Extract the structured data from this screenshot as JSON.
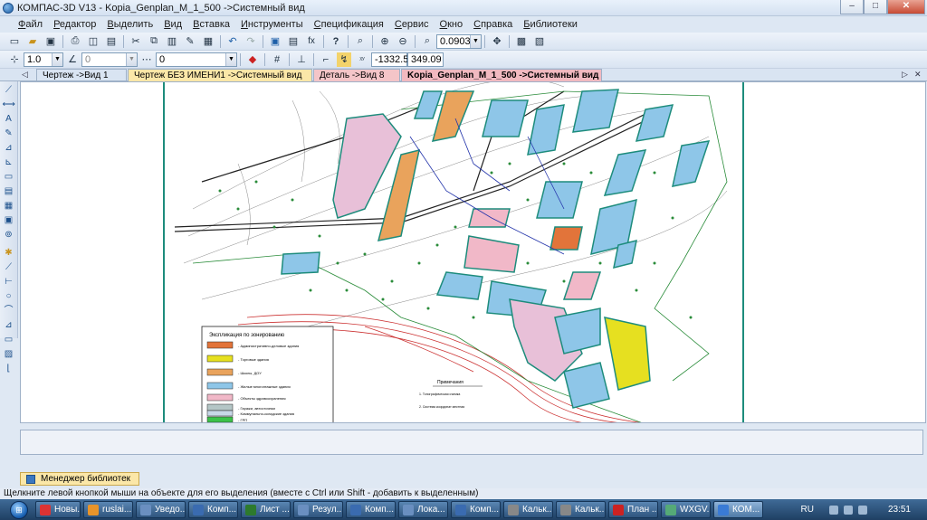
{
  "window": {
    "title": "КОМПАС-3D V13 - Kopia_Genplan_M_1_500 ->Системный вид",
    "minimize": "–",
    "maximize": "□",
    "close": "✕"
  },
  "menu": [
    "Файл",
    "Редактор",
    "Выделить",
    "Вид",
    "Вставка",
    "Инструменты",
    "Спецификация",
    "Сервис",
    "Окно",
    "Справка",
    "Библиотеки"
  ],
  "toolbar": {
    "zoom_value": "0.0903",
    "step_value": "1.0",
    "angle_value": "0",
    "style_value": "0",
    "coord_x": "-1332.5",
    "coord_y": "349.09"
  },
  "tabs": [
    {
      "label": "Чертеж ->Вид 1",
      "bg": "#eef2f8"
    },
    {
      "label": "Чертеж БЕЗ ИМЕНИ1 ->Системный вид",
      "bg": "#fbe7a8"
    },
    {
      "label": "Деталь ->Вид 8",
      "bg": "#f4c5c8"
    },
    {
      "label": "Kopia_Genplan_M_1_500 ->Системный вид",
      "bg": "#f1b9c0"
    }
  ],
  "legend": {
    "title": "Экспликация по зонированию",
    "items": [
      {
        "color": "#e2743a",
        "text": "- Административно-деловые здания"
      },
      {
        "color": "#e6e020",
        "text": "- Торговые здания"
      },
      {
        "color": "#e9a35c",
        "text": "- Школы, ДОУ"
      },
      {
        "color": "#8ec6e8",
        "text": "- Жилые многоэтажные здания"
      },
      {
        "color": "#f1b8c8",
        "text": "- Объекты здравоохранения"
      },
      {
        "color": "#b4c6c6",
        "text": "- Гаражи, автостоянки"
      },
      {
        "color": "#c8d8e8",
        "text": "- Коммунально-складские здания"
      },
      {
        "color": "#3cc24a",
        "text": "- ГРП"
      }
    ]
  },
  "notes": {
    "title": "Примечания",
    "lines": [
      "1. Топографическая съемка",
      "2. Система координат местная"
    ]
  },
  "library_manager": "Менеджер библиотек",
  "status": "Щелкните левой кнопкой мыши на объекте для его выделения (вместе с Ctrl или Shift - добавить к выделенным)",
  "taskbar": {
    "start": "⊞",
    "tasks": [
      {
        "label": "Новы...",
        "color": "#d33"
      },
      {
        "label": "ruslai...",
        "color": "#e8942a"
      },
      {
        "label": "Уведо...",
        "color": "#6a8fc0"
      },
      {
        "label": "Комп...",
        "color": "#3a6bb0"
      },
      {
        "label": "Лист ...",
        "color": "#2d7a2d"
      },
      {
        "label": "Резул...",
        "color": "#6a8fc0"
      },
      {
        "label": "Комп...",
        "color": "#3a6bb0"
      },
      {
        "label": "Лока...",
        "color": "#6a8fc0"
      },
      {
        "label": "Комп...",
        "color": "#3a6bb0"
      },
      {
        "label": "Кальк...",
        "color": "#888"
      },
      {
        "label": "Кальк...",
        "color": "#888"
      },
      {
        "label": "План ...",
        "color": "#c22"
      },
      {
        "label": "WXGV...",
        "color": "#5a7"
      },
      {
        "label": "КОМ...",
        "color": "#3a7bd5"
      }
    ],
    "lang": "RU",
    "time": "23:51"
  }
}
